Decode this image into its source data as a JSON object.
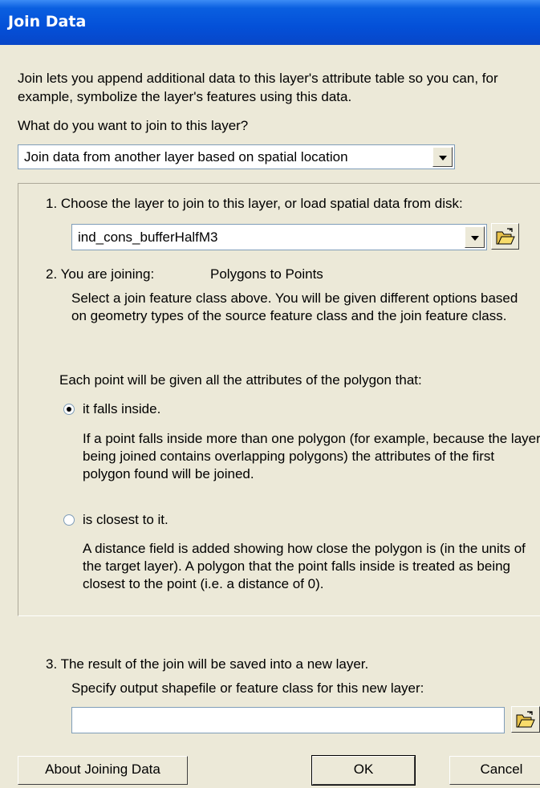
{
  "window": {
    "title": "Join Data"
  },
  "intro_text": "Join lets you append additional data to this layer's attribute table so you can, for example, symbolize the layer's features using this data.",
  "join_question": "What do you want to join to this layer?",
  "join_type_select": {
    "value": "Join data from another layer based on spatial location"
  },
  "step1": {
    "label": "1.  Choose the layer to join to this layer, or load spatial data from disk:",
    "layer_select_value": "ind_cons_bufferHalfM3",
    "folder_icon": "open-folder-icon"
  },
  "step2": {
    "label": "2.  You are joining:",
    "joining_value": "Polygons to Points",
    "description": "Select a join feature class above.  You will be given different options based on geometry types of the source feature class and the join feature class."
  },
  "point_options": {
    "heading": "Each point will be given all the attributes of the polygon that:",
    "option_inside": {
      "label": "it falls inside.",
      "selected": true,
      "description": "If a point falls inside more than one polygon (for example, because the layer being joined contains overlapping polygons) the attributes of the first polygon found will be joined."
    },
    "option_closest": {
      "label": "is closest to it.",
      "selected": false,
      "description": "A distance field is added showing how close the polygon is (in the units of the target layer). A polygon that the point falls inside is treated as being closest to the point (i.e. a distance of 0)."
    }
  },
  "step3": {
    "label": "3.  The result of the join will be saved into a new layer.",
    "sublabel": "Specify output shapefile or feature class for this new layer:",
    "output_value": "",
    "folder_icon": "open-folder-icon"
  },
  "buttons": {
    "about": "About Joining Data",
    "ok": "OK",
    "cancel": "Cancel"
  }
}
